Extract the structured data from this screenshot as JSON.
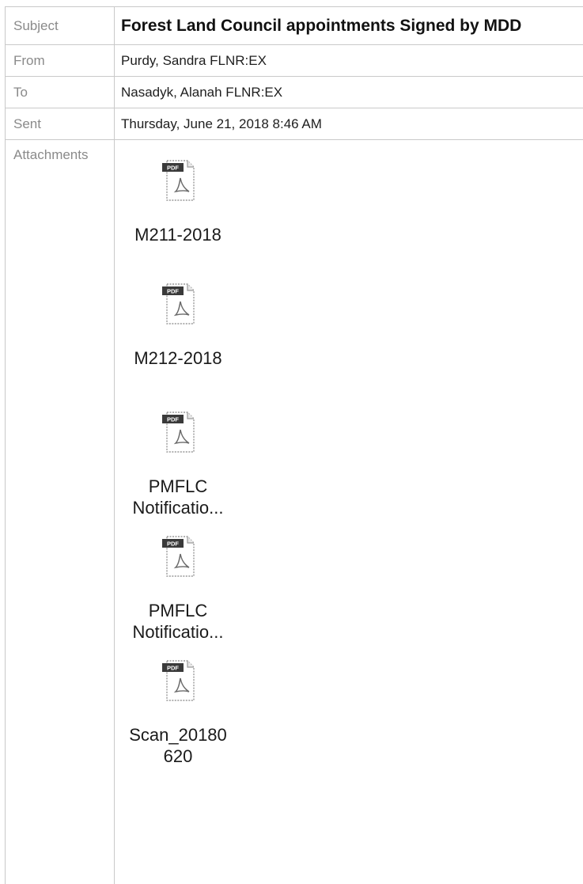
{
  "email": {
    "subject_label": "Subject",
    "subject": "Forest Land Council appointments Signed by MDD",
    "from_label": "From",
    "from": "Purdy, Sandra FLNR:EX",
    "to_label": "To",
    "to": "Nasadyk, Alanah FLNR:EX",
    "sent_label": "Sent",
    "sent": "Thursday, June 21, 2018 8:46 AM",
    "attachments_label": "Attachments",
    "attachments": [
      {
        "name": "M211-2018",
        "icon": "pdf-file-icon",
        "badge": "PDF"
      },
      {
        "name": "M212-2018",
        "icon": "pdf-file-icon",
        "badge": "PDF"
      },
      {
        "name": "PMFLC Notificatio...",
        "icon": "pdf-file-icon",
        "badge": "PDF"
      },
      {
        "name": "PMFLC Notificatio...",
        "icon": "pdf-file-icon",
        "badge": "PDF"
      },
      {
        "name": "Scan_20180 620",
        "icon": "pdf-file-icon",
        "badge": "PDF"
      }
    ]
  },
  "colors": {
    "border": "#c9c9c9",
    "label_text": "#8a8a8a",
    "value_text": "#1e1e1e",
    "pdf_badge": "#3a3a3a"
  }
}
